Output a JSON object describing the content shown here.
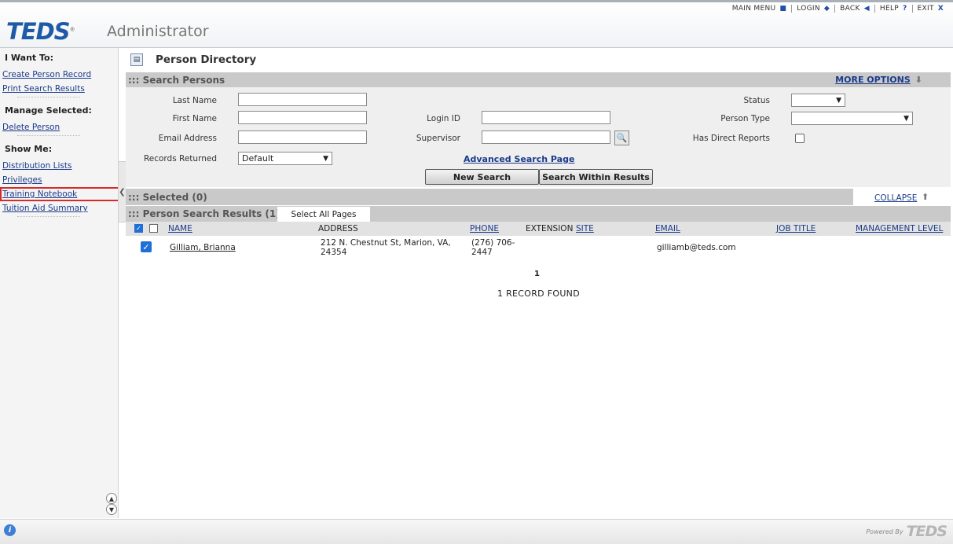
{
  "topnav": {
    "main_menu": "MAIN MENU",
    "login": "LOGIN",
    "back": "BACK",
    "help": "HELP",
    "exit": "EXIT"
  },
  "header": {
    "logo": "TEDS",
    "app_title": "Administrator"
  },
  "sidebar": {
    "i_want_to": "I Want To:",
    "create_person": "Create Person Record",
    "print_results": "Print Search Results",
    "manage_selected": "Manage Selected:",
    "delete_person": "Delete Person",
    "show_me": "Show Me:",
    "distribution_lists": "Distribution Lists",
    "privileges": "Privileges",
    "training_notebook": "Training Notebook",
    "tuition_aid": "Tuition Aid Summary"
  },
  "main": {
    "page_title": "Person Directory",
    "search_section": "::: Search Persons",
    "more_options": "MORE OPTIONS",
    "fields": {
      "last_name": "Last Name",
      "first_name": "First Name",
      "email_address": "Email Address",
      "records_returned": "Records Returned",
      "records_returned_value": "Default",
      "login_id": "Login ID",
      "supervisor": "Supervisor",
      "status": "Status",
      "person_type": "Person Type",
      "has_direct_reports": "Has Direct Reports"
    },
    "advanced_search": "Advanced Search Page",
    "new_search": "New Search",
    "search_within": "Search Within Results",
    "selected_section": "::: Selected (0)",
    "collapse": "COLLAPSE",
    "results_section": "::: Person Search Results (1)",
    "select_all_pages": "Select All Pages",
    "columns": {
      "name": "NAME",
      "address": "ADDRESS",
      "phone": "PHONE",
      "extension": "EXTENSION",
      "site": "SITE",
      "email": "EMAIL",
      "job_title": "JOB TITLE",
      "management_level": "MANAGEMENT LEVEL"
    },
    "row": {
      "name": "Gilliam, Brianna",
      "address_line1": "212 N. Chestnut St, Marion, VA,",
      "address_line2": "24354",
      "phone_line1": "(276) 706-",
      "phone_line2": "2447",
      "email": "gilliamb@teds.com"
    },
    "page_number": "1",
    "records_found": "1  RECORD FOUND"
  },
  "footer": {
    "powered_by": "Powered By",
    "logo": "TEDS"
  }
}
